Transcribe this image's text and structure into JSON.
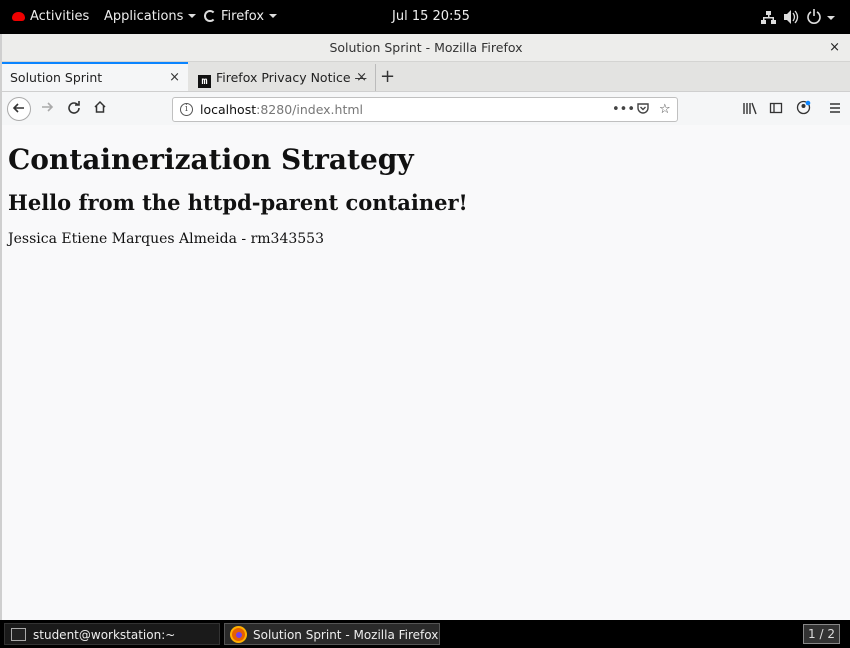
{
  "topbar": {
    "activities": "Activities",
    "applications": "Applications",
    "firefox": "Firefox",
    "clock": "Jul 15  20:55"
  },
  "window": {
    "title": "Solution Sprint - Mozilla Firefox",
    "close": "×"
  },
  "tabs": [
    {
      "label": "Solution Sprint",
      "close": "×"
    },
    {
      "label": "Firefox Privacy Notice —",
      "close": "×",
      "icon_letter": "m"
    }
  ],
  "newtab": "+",
  "urlbar": {
    "host": "localhost",
    "rest": ":8280/index.html"
  },
  "page": {
    "heading": "Containerization Strategy",
    "subheading": "Hello from the httpd-parent container!",
    "text": "Jessica Etiene Marques Almeida - rm343553"
  },
  "taskbar": {
    "terminal": "student@workstation:~",
    "firefox": "Solution Sprint - Mozilla Firefox",
    "workspace": "1 / 2"
  },
  "colors": {
    "accent": "#0a84ff",
    "redhat": "#ee0000"
  }
}
